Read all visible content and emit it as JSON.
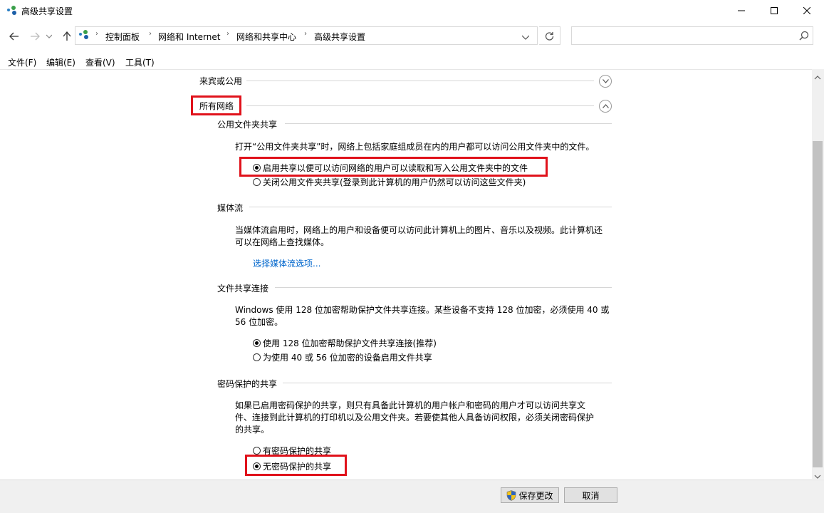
{
  "window": {
    "title": "高级共享设置",
    "minimize_icon": "minimize-icon",
    "maximize_icon": "maximize-icon",
    "close_icon": "close-icon"
  },
  "address_bar": {
    "breadcrumbs": [
      "控制面板",
      "网络和 Internet",
      "网络和共享中心",
      "高级共享设置"
    ],
    "search_placeholder": ""
  },
  "menu": [
    "文件(F)",
    "编辑(E)",
    "查看(V)",
    "工具(T)"
  ],
  "sections": {
    "guest_public": {
      "label": "来宾或公用"
    },
    "all_networks": {
      "label": "所有网络"
    }
  },
  "public_folder": {
    "heading": "公用文件夹共享",
    "description": "打开“公用文件夹共享”时，网络上包括家庭组成员在内的用户都可以访问公用文件夹中的文件。",
    "options": [
      {
        "label": "启用共享以便可以访问网络的用户可以读取和写入公用文件夹中的文件",
        "checked": true
      },
      {
        "label": "关闭公用文件夹共享(登录到此计算机的用户仍然可以访问这些文件夹)",
        "checked": false
      }
    ]
  },
  "media": {
    "heading": "媒体流",
    "description": "当媒体流启用时，网络上的用户和设备便可以访问此计算机上的图片、音乐以及视频。此计算机还可以在网络上查找媒体。",
    "link": "选择媒体流选项..."
  },
  "file_sharing": {
    "heading": "文件共享连接",
    "description": "Windows 使用 128 位加密帮助保护文件共享连接。某些设备不支持 128 位加密，必须使用 40 或 56 位加密。",
    "options": [
      {
        "label": "使用 128 位加密帮助保护文件共享连接(推荐)",
        "checked": true
      },
      {
        "label": "为使用 40 或 56 位加密的设备启用文件共享",
        "checked": false
      }
    ]
  },
  "password": {
    "heading": "密码保护的共享",
    "description": "如果已启用密码保护的共享，则只有具备此计算机的用户帐户和密码的用户才可以访问共享文件、连接到此计算机的打印机以及公用文件夹。若要使其他人具备访问权限，必须关闭密码保护的共享。",
    "options": [
      {
        "label": "有密码保护的共享",
        "checked": false
      },
      {
        "label": "无密码保护的共享",
        "checked": true
      }
    ]
  },
  "footer": {
    "save_label": "保存更改",
    "cancel_label": "取消"
  },
  "colors": {
    "highlight": "#e0121b",
    "link": "#0066cc"
  }
}
